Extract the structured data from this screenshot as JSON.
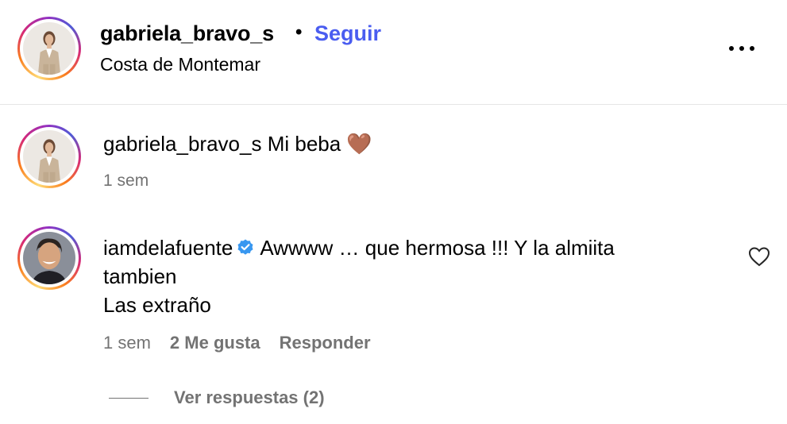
{
  "post": {
    "username": "gabriela_bravo_s",
    "separator": "•",
    "follow_label": "Seguir",
    "location": "Costa de Montemar"
  },
  "caption": {
    "username": "gabriela_bravo_s",
    "text": "Mi beba 🤎",
    "time": "1 sem"
  },
  "comment": {
    "username": "iamdelafuente",
    "verified": true,
    "line1": "Awwww … que hermosa !!! Y la almiita",
    "line2": "tambien",
    "line3": "Las extraño",
    "time": "1 sem",
    "likes": "2 Me gusta",
    "reply_label": "Responder"
  },
  "replies": {
    "label": "Ver respuestas (2)"
  },
  "icons": {
    "more": "more-options-icon",
    "like": "heart-icon",
    "verified": "verified-badge-icon"
  },
  "colors": {
    "accent": "#4a5df0",
    "muted": "#737373",
    "verified": "#3897f0"
  }
}
